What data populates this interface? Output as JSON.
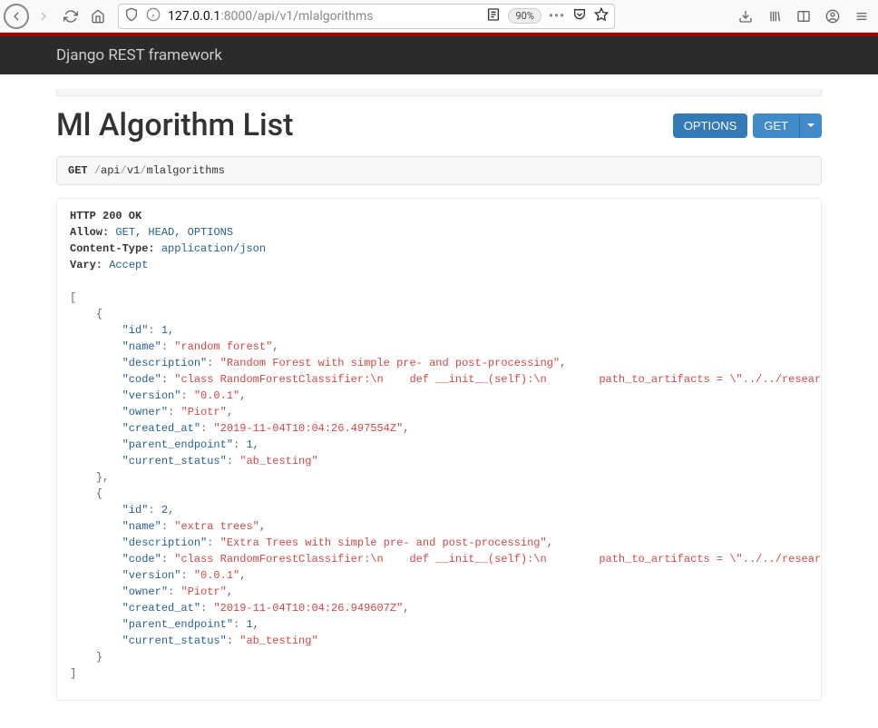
{
  "browser": {
    "url_host": "127.0.0.1",
    "url_port_path": ":8000/api/v1/mlalgorithms",
    "zoom": "90%"
  },
  "nav": {
    "brand": "Django REST framework"
  },
  "page": {
    "title": "Ml Algorithm List",
    "options_label": "OPTIONS",
    "get_label": "GET"
  },
  "request": {
    "method": "GET",
    "path_segments": [
      "api",
      "v1",
      "mlalgorithms"
    ]
  },
  "response": {
    "status_line": "HTTP 200 OK",
    "headers": {
      "allow_label": "Allow:",
      "allow_value": "GET, HEAD, OPTIONS",
      "content_type_label": "Content-Type:",
      "content_type_value": "application/json",
      "vary_label": "Vary:",
      "vary_value": "Accept"
    },
    "body": [
      {
        "id": 1,
        "name": "random forest",
        "description": "Random Forest with simple pre- and post-processing",
        "code": "class RandomForestClassifier:\\n    def __init__(self):\\n        path_to_artifacts = \\\"../../research/\\\"\\n        self.valu",
        "version": "0.0.1",
        "owner": "Piotr",
        "created_at": "2019-11-04T10:04:26.497554Z",
        "parent_endpoint": 1,
        "current_status": "ab_testing"
      },
      {
        "id": 2,
        "name": "extra trees",
        "description": "Extra Trees with simple pre- and post-processing",
        "code": "class RandomForestClassifier:\\n    def __init__(self):\\n        path_to_artifacts = \\\"../../research/\\\"\\n        self.valu",
        "version": "0.0.1",
        "owner": "Piotr",
        "created_at": "2019-11-04T10:04:26.949607Z",
        "parent_endpoint": 1,
        "current_status": "ab_testing"
      }
    ]
  }
}
